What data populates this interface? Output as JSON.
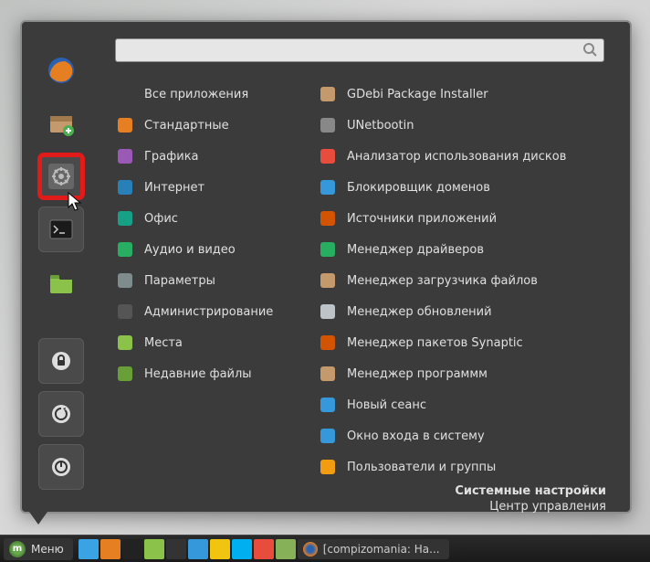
{
  "search": {
    "placeholder": ""
  },
  "categories": [
    {
      "label": "Все приложения",
      "icon": "apps",
      "color": "transparent"
    },
    {
      "label": "Стандартные",
      "icon": "calc",
      "color": "#e67e22"
    },
    {
      "label": "Графика",
      "icon": "palette",
      "color": "#9b59b6"
    },
    {
      "label": "Интернет",
      "icon": "globe",
      "color": "#2980b9"
    },
    {
      "label": "Офис",
      "icon": "office",
      "color": "#16a085"
    },
    {
      "label": "Аудио и видео",
      "icon": "media",
      "color": "#27ae60"
    },
    {
      "label": "Параметры",
      "icon": "sliders",
      "color": "#7f8c8d"
    },
    {
      "label": "Администрирование",
      "icon": "gear",
      "color": "#555"
    },
    {
      "label": "Места",
      "icon": "folder",
      "color": "#8bc34a"
    },
    {
      "label": "Недавние файлы",
      "icon": "recent",
      "color": "#689f38"
    }
  ],
  "apps": [
    {
      "label": "GDebi Package Installer",
      "icon": "package",
      "color": "#c49a6c"
    },
    {
      "label": "UNetbootin",
      "icon": "disc",
      "color": "#888"
    },
    {
      "label": "Анализатор использования дисков",
      "icon": "pie",
      "color": "#e74c3c"
    },
    {
      "label": "Блокировщик доменов",
      "icon": "shield",
      "color": "#3498db"
    },
    {
      "label": "Источники приложений",
      "icon": "source",
      "color": "#d35400"
    },
    {
      "label": "Менеджер драйверов",
      "icon": "chip",
      "color": "#27ae60"
    },
    {
      "label": "Менеджер загрузчика файлов",
      "icon": "download",
      "color": "#c49a6c"
    },
    {
      "label": "Менеджер обновлений",
      "icon": "update",
      "color": "#bdc3c7"
    },
    {
      "label": "Менеджер пакетов Synaptic",
      "icon": "synaptic",
      "color": "#d35400"
    },
    {
      "label": "Менеджер программм",
      "icon": "software",
      "color": "#c49a6c"
    },
    {
      "label": "Новый сеанс",
      "icon": "session",
      "color": "#3498db"
    },
    {
      "label": "Окно входа в систему",
      "icon": "login",
      "color": "#3498db"
    },
    {
      "label": "Пользователи и группы",
      "icon": "users",
      "color": "#f39c12"
    }
  ],
  "footer": {
    "line1": "Системные настройки",
    "line2": "Центр управления"
  },
  "favorites": [
    {
      "name": "firefox",
      "color": "#e67e22"
    },
    {
      "name": "package-installer",
      "color": "#c49a6c"
    },
    {
      "name": "system-settings",
      "color": "#777",
      "highlighted": true
    },
    {
      "name": "terminal",
      "color": "#222"
    },
    {
      "name": "file-manager",
      "color": "#8bc34a"
    }
  ],
  "session_buttons": [
    {
      "name": "lock",
      "glyph": "🔒"
    },
    {
      "name": "logout",
      "glyph": "⟳"
    },
    {
      "name": "shutdown",
      "glyph": "⏻"
    }
  ],
  "taskbar": {
    "menu_label": "Меню",
    "icons": [
      {
        "name": "show-desktop",
        "color": "#3aa3e3"
      },
      {
        "name": "firefox",
        "color": "#e67e22"
      },
      {
        "name": "terminal",
        "color": "#222"
      },
      {
        "name": "files",
        "color": "#8bc34a"
      },
      {
        "name": "camera",
        "color": "#333"
      },
      {
        "name": "dev",
        "color": "#3498db"
      },
      {
        "name": "tool",
        "color": "#f1c40f"
      },
      {
        "name": "skype",
        "color": "#00aff0"
      },
      {
        "name": "viewer",
        "color": "#e74c3c"
      },
      {
        "name": "mint",
        "color": "#87b158"
      }
    ],
    "task": {
      "icon_color": "#e67e22",
      "label": "[compizomania: На..."
    }
  }
}
